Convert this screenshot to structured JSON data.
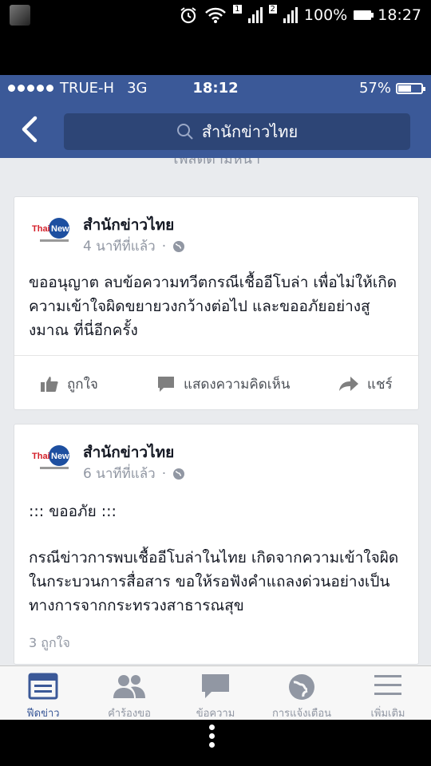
{
  "android_status": {
    "battery": "100%",
    "time": "18:27",
    "sim1": "1",
    "sim2": "2"
  },
  "ios_status": {
    "carrier": "TRUE-H",
    "network": "3G",
    "time": "18:12",
    "battery": "57%",
    "battery_level": 0.57
  },
  "header": {
    "search_text": "สำนักข่าวไทย"
  },
  "section_label": "โพสต์ตามหน้า",
  "posts": [
    {
      "page_name": "สำนักข่าวไทย",
      "time": "4 นาทีที่แล้ว",
      "text": "ขออนุญาต ลบข้อความทวีตกรณีเชื้ออีโบล่า เพื่อไม่ให้เกิดความเข้าใจผิดขยายวงกว้างต่อไป และขออภัยอย่างสูงมาณ ที่นี่อีกครั้ง",
      "actions": {
        "like": "ถูกใจ",
        "comment": "แสดงความคิดเห็น",
        "share": "แชร์"
      }
    },
    {
      "page_name": "สำนักข่าวไทย",
      "time": "6 นาทีที่แล้ว",
      "text1": "::: ขออภัย :::",
      "text2": "กรณีข่าวการพบเชื้ออีโบล่าในไทย เกิดจากความเข้าใจผิดในกระบวนการสื่อสาร ขอให้รอฟังคำแถลงด่วนอย่างเป็นทางการจากกระทรวงสาธารณสุข",
      "likes": "3 ถูกใจ"
    }
  ],
  "logo": {
    "thai": "Thai",
    "news": "News"
  },
  "tabs": [
    {
      "label": "ฟีดข่าว",
      "icon": "news-feed-icon"
    },
    {
      "label": "คำร้องขอ",
      "icon": "friend-requests-icon"
    },
    {
      "label": "ข้อความ",
      "icon": "messages-icon"
    },
    {
      "label": "การแจ้งเตือน",
      "icon": "globe-notifications-icon"
    },
    {
      "label": "เพิ่มเติม",
      "icon": "menu-icon"
    }
  ],
  "colors": {
    "fb_blue": "#3b5998",
    "search_bg": "#2d4576",
    "feed_bg": "#e9ebee",
    "meta_gray": "#9197a3"
  }
}
